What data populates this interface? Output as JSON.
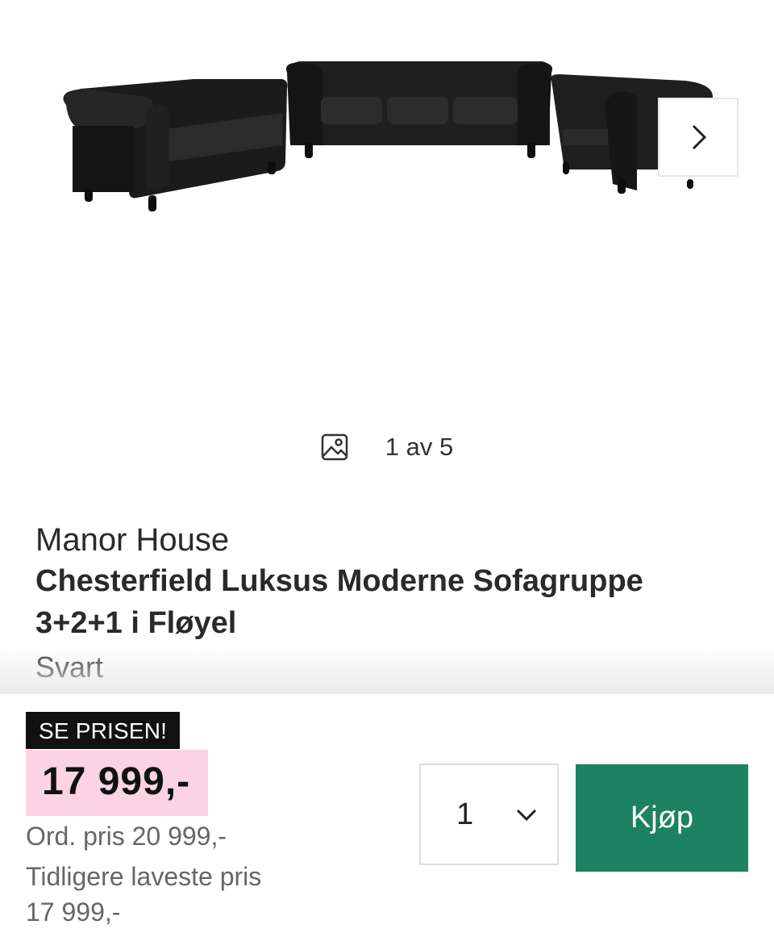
{
  "gallery": {
    "image_alt": "Chesterfield sofagruppe 3+2+1 svart fløyel",
    "counter_text": "1 av 5",
    "image_icon": "image-icon",
    "next_icon": "chevron-right-icon"
  },
  "product": {
    "brand": "Manor House",
    "title_line1": "Chesterfield Luksus Moderne Sofagruppe",
    "title_line2": "3+2+1 i Fløyel",
    "variant": "Svart"
  },
  "pricing": {
    "badge": "SE PRISEN!",
    "price": "17 999,-",
    "ordinary": "Ord. pris 20 999,-",
    "lowest_label": "Tidligere laveste pris",
    "lowest_value": "17 999,-",
    "badge_color": "#111111",
    "price_bg_color": "#fbd3e3"
  },
  "purchase": {
    "quantity": "1",
    "quantity_icon": "chevron-down-icon",
    "buy_label": "Kjøp",
    "buy_color": "#1d8262"
  }
}
